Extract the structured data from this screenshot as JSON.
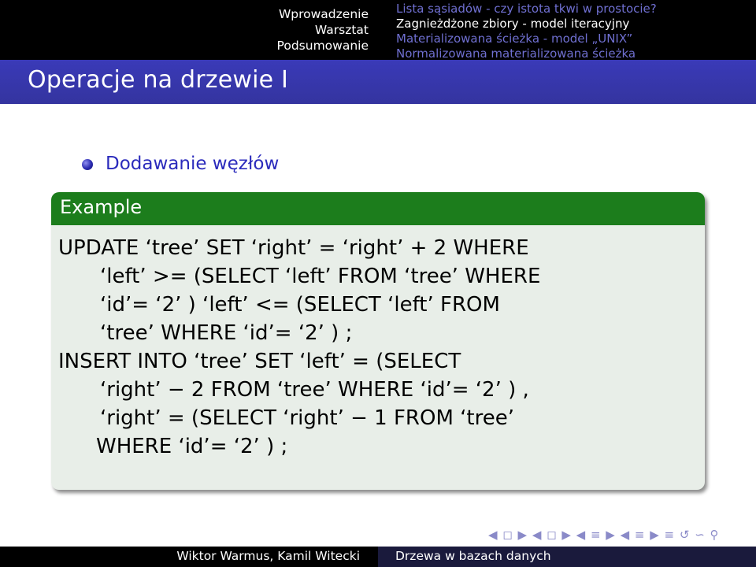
{
  "nav": {
    "sections": [
      "Wprowadzenie",
      "Warsztat",
      "Podsumowanie"
    ],
    "subsections": [
      "Lista sąsiadów - czy istota tkwi w prostocie?",
      "Zagnieżdżone zbiory - model iteracyjny",
      "Materializowana ścieżka - model „UNIX”",
      "Normalizowana materializowana ścieżka"
    ]
  },
  "frame": {
    "title": "Operacje na drzewie I"
  },
  "bullet": {
    "text": "Dodawanie węzłów"
  },
  "example": {
    "title": "Example",
    "code_lines": [
      "UPDATE  ‘tree’  SET  ‘right’ = ‘right’ + 2 WHERE",
      "‘left’ >= (SELECT  ‘left’  FROM  ‘tree’  WHERE",
      "‘id’= ‘2’ )  ‘left’  <= (SELECT  ‘left’  FROM",
      "‘tree’  WHERE  ‘id’= ‘2’ ) ;",
      "INSERT  INTO  ‘tree’  SET  ‘left’ = (SELECT",
      "‘right’ − 2 FROM  ‘tree’  WHERE  ‘id’= ‘2’ ) ,",
      "‘right’ = (SELECT  ‘right’ − 1 FROM  ‘tree’",
      "WHERE  ‘id’= ‘2’ ) ;"
    ]
  },
  "nav_symbols": "◀ ◻ ▶ ◀ ◻ ▶ ◀ ≡ ▶ ◀ ≡ ▶ ≡ ↺ ∽ ⚲",
  "footer": {
    "authors": "Wiktor Warmus, Kamil Witecki",
    "topic": "Drzewa w bazach danych"
  },
  "colors": {
    "title_bar": "#3636a8",
    "block_header": "#1c7d1c",
    "block_body": "#e8eee8",
    "bullet_text": "#2b2bbc"
  }
}
